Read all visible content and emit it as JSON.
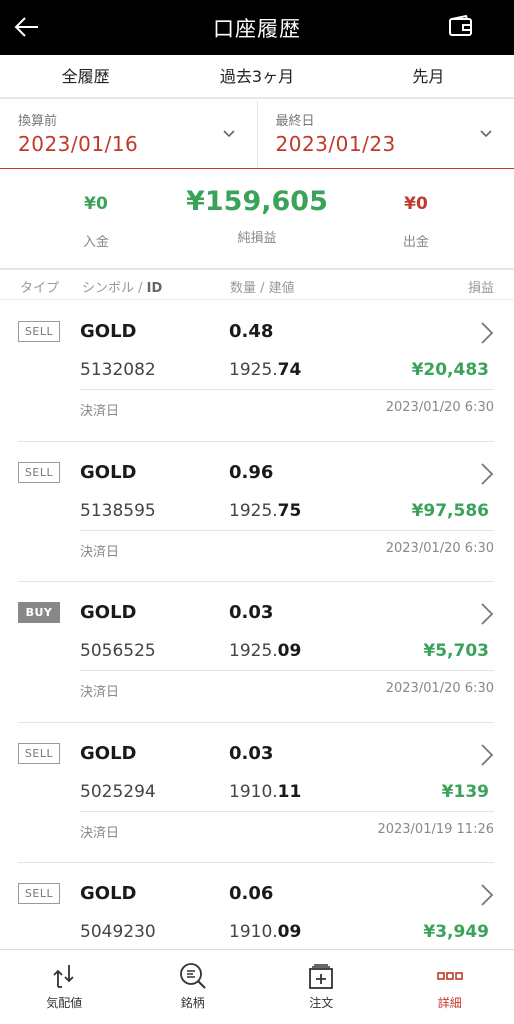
{
  "header": {
    "title": "口座履歴"
  },
  "period_tabs": [
    "全履歴",
    "過去3ヶ月",
    "先月"
  ],
  "date_range": {
    "start_label": "換算前",
    "start_value": "2023/01/16",
    "end_label": "最終日",
    "end_value": "2023/01/23"
  },
  "summary": {
    "deposit_value": "¥0",
    "deposit_label": "入金",
    "net_value": "¥159,605",
    "net_label": "純損益",
    "withdraw_value": "¥0",
    "withdraw_label": "出金"
  },
  "columns": {
    "type": "タイプ",
    "symbol": "シンボル / ",
    "symbol_id": "ID",
    "qty": "数量 / 建値",
    "pnl": "損益"
  },
  "settled_label": "決済日",
  "trades": [
    {
      "type": "SELL",
      "symbol": "GOLD",
      "qty": "0.48",
      "id": "5132082",
      "price_main": "1925.",
      "price_frac": "74",
      "pnl": "¥20,483",
      "date": "2023/01/20 6:30"
    },
    {
      "type": "SELL",
      "symbol": "GOLD",
      "qty": "0.96",
      "id": "5138595",
      "price_main": "1925.",
      "price_frac": "75",
      "pnl": "¥97,586",
      "date": "2023/01/20 6:30"
    },
    {
      "type": "BUY",
      "symbol": "GOLD",
      "qty": "0.03",
      "id": "5056525",
      "price_main": "1925.",
      "price_frac": "09",
      "pnl": "¥5,703",
      "date": "2023/01/20 6:30"
    },
    {
      "type": "SELL",
      "symbol": "GOLD",
      "qty": "0.03",
      "id": "5025294",
      "price_main": "1910.",
      "price_frac": "11",
      "pnl": "¥139",
      "date": "2023/01/19 11:26"
    },
    {
      "type": "SELL",
      "symbol": "GOLD",
      "qty": "0.06",
      "id": "5049230",
      "price_main": "1910.",
      "price_frac": "09",
      "pnl": "¥3,949",
      "date": ""
    }
  ],
  "bottom_nav": [
    {
      "label": "気配値",
      "icon": "quotes-icon",
      "active": false
    },
    {
      "label": "銘柄",
      "icon": "symbol-search-icon",
      "active": false
    },
    {
      "label": "注文",
      "icon": "order-icon",
      "active": false
    },
    {
      "label": "詳細",
      "icon": "details-icon",
      "active": true
    }
  ],
  "colors": {
    "accent": "#c0392b",
    "profit": "#3aa35a",
    "header_bg": "#000000"
  }
}
